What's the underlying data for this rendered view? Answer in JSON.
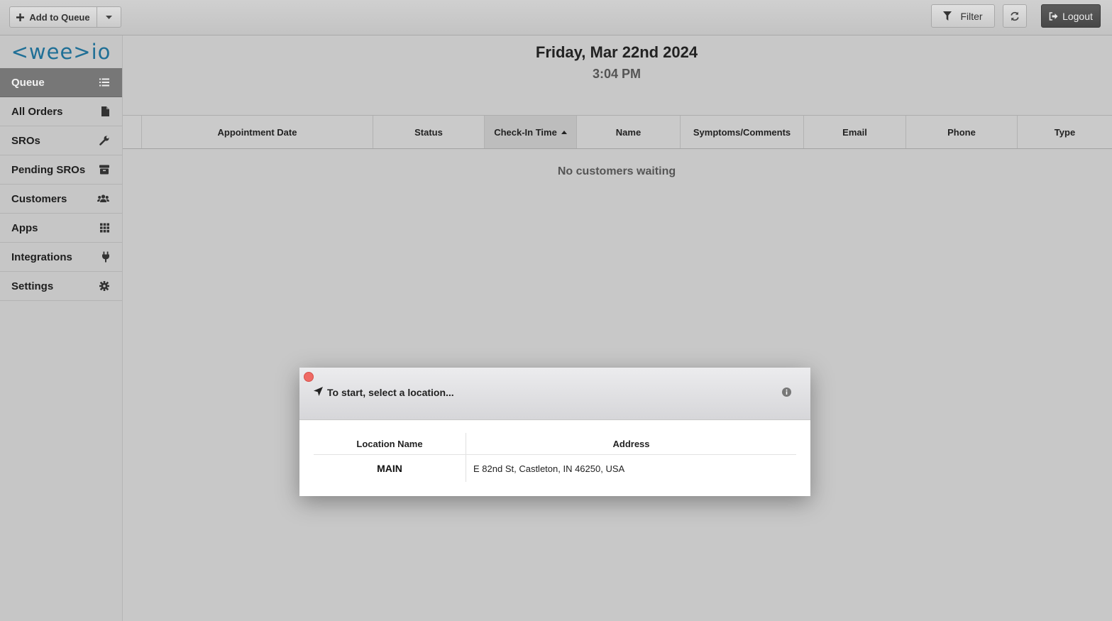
{
  "toolbar": {
    "add_to_queue_label": "Add to Queue",
    "filter_label": "Filter",
    "logout_label": "Logout"
  },
  "sidebar": {
    "logo_text": "<wee>io",
    "items": [
      {
        "label": "Queue",
        "icon": "list-icon",
        "active": true
      },
      {
        "label": "All Orders",
        "icon": "file-icon"
      },
      {
        "label": "SROs",
        "icon": "wrench-icon"
      },
      {
        "label": "Pending SROs",
        "icon": "box-icon"
      },
      {
        "label": "Customers",
        "icon": "users-icon"
      },
      {
        "label": "Apps",
        "icon": "grid-icon"
      },
      {
        "label": "Integrations",
        "icon": "plug-icon"
      },
      {
        "label": "Settings",
        "icon": "gear-icon"
      }
    ]
  },
  "main": {
    "date": "Friday, Mar 22nd 2024",
    "time": "3:04 PM",
    "columns": [
      "Appointment Date",
      "Status",
      "Check-In Time",
      "Name",
      "Symptoms/Comments",
      "Email",
      "Phone",
      "Type"
    ],
    "sorted_column": "Check-In Time",
    "sort_direction": "ascending",
    "empty_message": "No customers waiting"
  },
  "modal": {
    "title": "To start, select a location...",
    "headers": {
      "location_name": "Location Name",
      "address": "Address"
    },
    "rows": [
      {
        "name": "MAIN",
        "address": "E 82nd St, Castleton, IN 46250, USA"
      }
    ]
  },
  "colors": {
    "logo": "#1f6f96",
    "active_nav": "#777777",
    "logout_button": "#4f4f4f",
    "close_dot": "#ef6a64"
  }
}
